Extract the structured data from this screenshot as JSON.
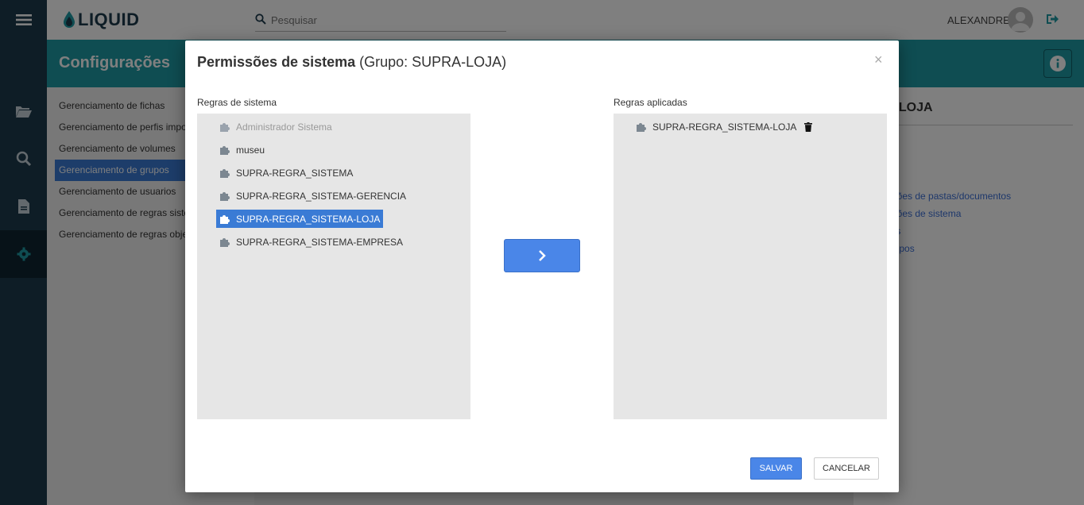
{
  "app": {
    "logo_text": "LIQUID",
    "search_placeholder": "Pesquisar",
    "user_name": "ALEXANDRE",
    "header_title": "Configurações"
  },
  "menu": {
    "items": [
      {
        "label": "Gerenciamento de fichas"
      },
      {
        "label": "Gerenciamento de perfis importação"
      },
      {
        "label": "Gerenciamento de volumes"
      },
      {
        "label": "Gerenciamento de grupos"
      },
      {
        "label": "Gerenciamento de usuarios"
      },
      {
        "label": "Gerenciamento de regras sistema"
      },
      {
        "label": "Gerenciamento de regras objetos"
      }
    ]
  },
  "right_panel": {
    "title": "A-LOJA",
    "links": [
      {
        "label": "r"
      },
      {
        "label": "ir"
      },
      {
        "label": "issões de pastas/documentos"
      },
      {
        "label": "issões de sistema"
      },
      {
        "label": "rios"
      },
      {
        "label": "grupos"
      }
    ]
  },
  "modal": {
    "title_bold": "Permissões de sistema",
    "title_rest": " (Grupo: SUPRA-LOJA)",
    "close_symbol": "×",
    "left_label": "Regras de sistema",
    "right_label": "Regras aplicadas",
    "available_rules": [
      {
        "label": "Administrador Sistema"
      },
      {
        "label": "museu"
      },
      {
        "label": "SUPRA-REGRA_SISTEMA"
      },
      {
        "label": "SUPRA-REGRA_SISTEMA-GERENCIA"
      },
      {
        "label": "SUPRA-REGRA_SISTEMA-LOJA"
      },
      {
        "label": "SUPRA-REGRA_SISTEMA-EMPRESA"
      }
    ],
    "applied_rules": [
      {
        "label": "SUPRA-REGRA_SISTEMA-LOJA"
      }
    ],
    "save_label": "SALVAR",
    "cancel_label": "CANCELAR"
  },
  "colors": {
    "sidebar": "#1d3a4c",
    "header": "#1e9aa5",
    "primary": "#4a86e8",
    "selected": "#3a7bd5"
  }
}
